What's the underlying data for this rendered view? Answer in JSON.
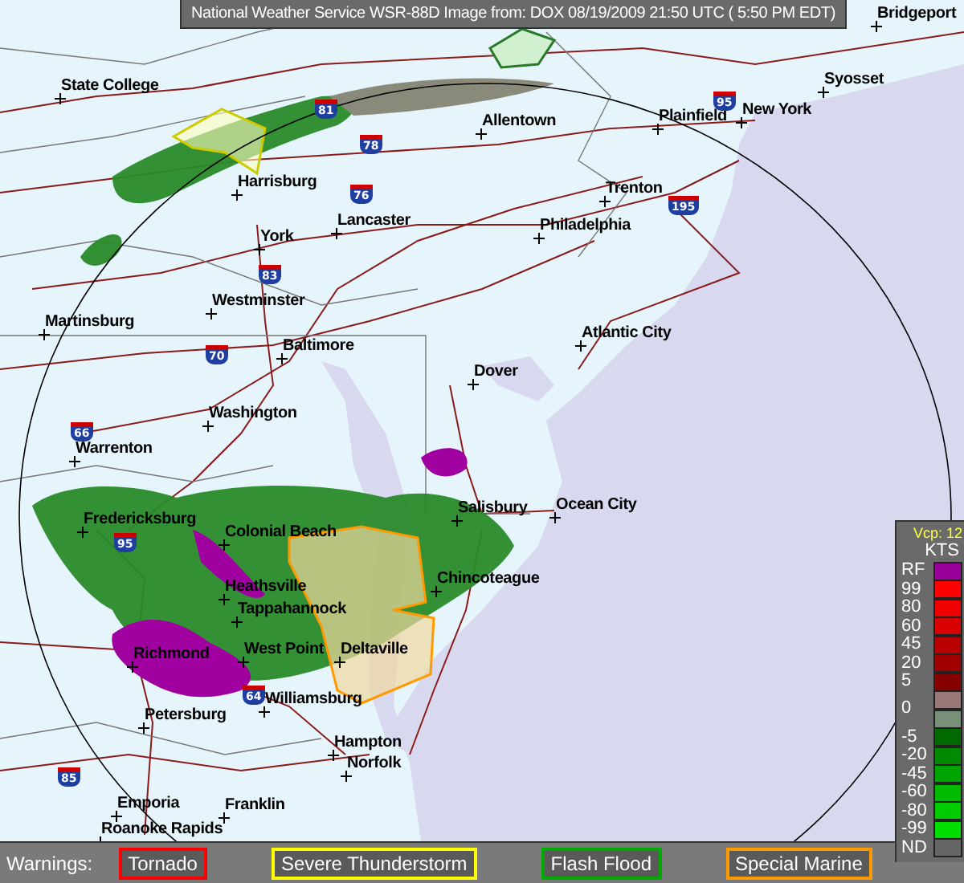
{
  "title_bar": {
    "text": "National Weather Service WSR-88D Image from: DOX 08/19/2009 21:50 UTC ( 5:50 PM EDT)"
  },
  "map": {
    "cities": [
      {
        "name": "Bridgeport"
      },
      {
        "name": "State College"
      },
      {
        "name": "Syosset"
      },
      {
        "name": "Plainfield"
      },
      {
        "name": "New York"
      },
      {
        "name": "Allentown"
      },
      {
        "name": "Harrisburg"
      },
      {
        "name": "Trenton"
      },
      {
        "name": "Lancaster"
      },
      {
        "name": "Philadelphia"
      },
      {
        "name": "York"
      },
      {
        "name": "Westminster"
      },
      {
        "name": "Martinsburg"
      },
      {
        "name": "Atlantic City"
      },
      {
        "name": "Baltimore"
      },
      {
        "name": "Dover"
      },
      {
        "name": "Washington"
      },
      {
        "name": "Warrenton"
      },
      {
        "name": "Ocean City"
      },
      {
        "name": "Salisbury"
      },
      {
        "name": "Fredericksburg"
      },
      {
        "name": "Colonial Beach"
      },
      {
        "name": "Heathsville"
      },
      {
        "name": "Chincoteague"
      },
      {
        "name": "Tappahannock"
      },
      {
        "name": "Richmond"
      },
      {
        "name": "West Point"
      },
      {
        "name": "Deltaville"
      },
      {
        "name": "Williamsburg"
      },
      {
        "name": "Petersburg"
      },
      {
        "name": "Hampton"
      },
      {
        "name": "Norfolk"
      },
      {
        "name": "Emporia"
      },
      {
        "name": "Franklin"
      },
      {
        "name": "Roanoke Rapids"
      }
    ],
    "highways": [
      {
        "number": "95"
      },
      {
        "number": "81"
      },
      {
        "number": "78"
      },
      {
        "number": "76"
      },
      {
        "number": "195"
      },
      {
        "number": "83"
      },
      {
        "number": "70"
      },
      {
        "number": "66"
      },
      {
        "number": "95"
      },
      {
        "number": "64"
      },
      {
        "number": "85"
      }
    ]
  },
  "legend": {
    "mode": "Vcp: 12",
    "unit": "KTS",
    "bins": [
      {
        "label": "RF",
        "color": "#990099"
      },
      {
        "label": "99",
        "color": "#ff0000"
      },
      {
        "label": "80",
        "color": "#ee0000"
      },
      {
        "label": "60",
        "color": "#d80000"
      },
      {
        "label": "45",
        "color": "#b80000"
      },
      {
        "label": "20",
        "color": "#a00000"
      },
      {
        "label": "5",
        "color": "#860000"
      },
      {
        "label": "0",
        "color": "#9a7878"
      },
      {
        "color": "#789078"
      },
      {
        "label": "-5",
        "color": "#006a00"
      },
      {
        "label": "-20",
        "color": "#008a00"
      },
      {
        "label": "-45",
        "color": "#00a400"
      },
      {
        "label": "-60",
        "color": "#00bb00"
      },
      {
        "label": "-80",
        "color": "#00cc00"
      },
      {
        "label": "-99",
        "color": "#00dd00"
      },
      {
        "label": "ND",
        "color": "#666666"
      }
    ]
  },
  "warnings": {
    "label": "Warnings:",
    "types": [
      {
        "label": "Tornado",
        "color": "#ff0000"
      },
      {
        "label": "Severe Thunderstorm",
        "color": "#ffff00"
      },
      {
        "label": "Flash Flood",
        "color": "#00aa00"
      },
      {
        "label": "Special Marine",
        "color": "#ff9900"
      }
    ]
  }
}
